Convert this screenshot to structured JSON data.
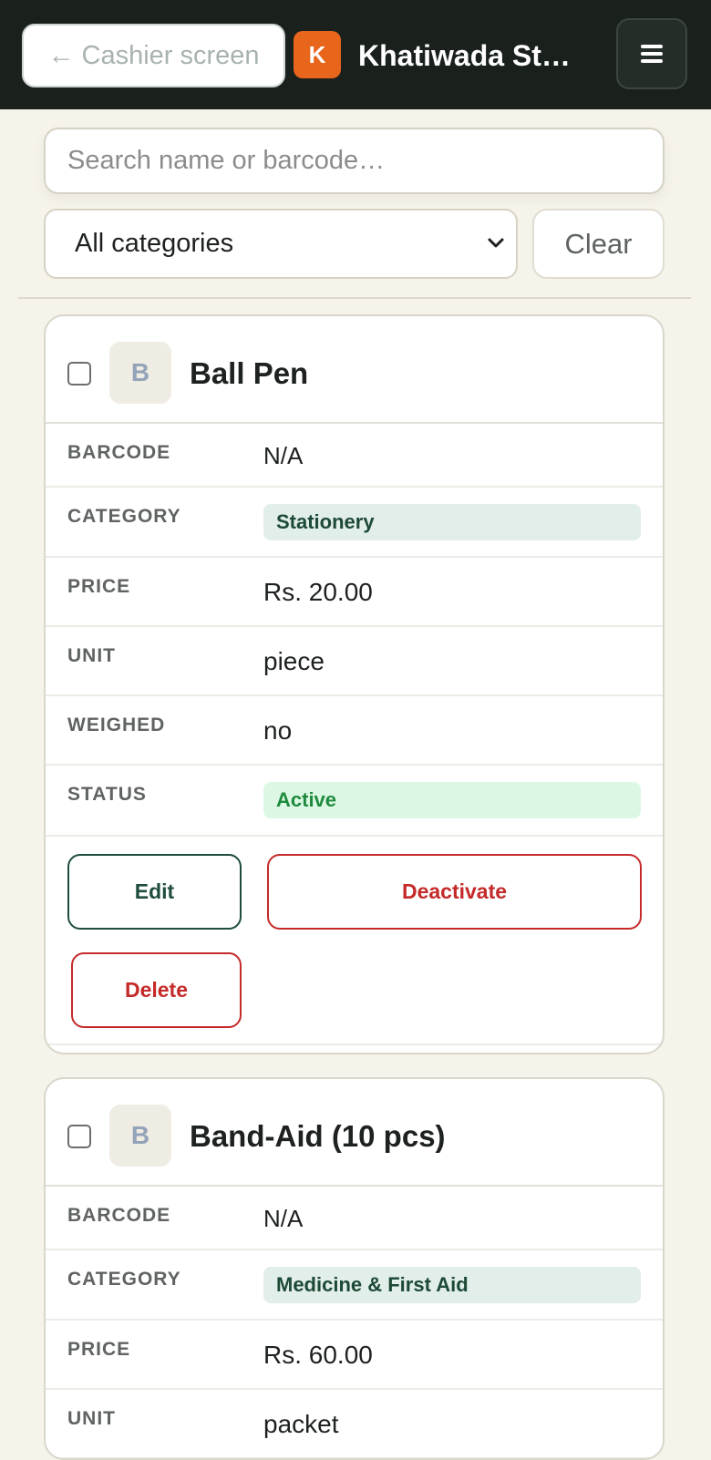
{
  "header": {
    "back_label": "← Cashier screen",
    "logo_letter": "K",
    "store_name": "Khatiwada St…",
    "menu_icon": "hamburger-icon"
  },
  "filters": {
    "search_placeholder": "Search name or barcode…",
    "search_value": "",
    "category_selected": "All categories",
    "clear_label": "Clear"
  },
  "field_labels": {
    "barcode": "BARCODE",
    "category": "CATEGORY",
    "price": "PRICE",
    "unit": "UNIT",
    "weighed": "WEIGHED",
    "status": "STATUS"
  },
  "products": [
    {
      "initial": "B",
      "name": "Ball Pen",
      "barcode": "N/A",
      "category": "Stationery",
      "price": "Rs. 20.00",
      "unit": "piece",
      "weighed": "no",
      "status": "Active",
      "actions": {
        "edit": "Edit",
        "deactivate": "Deactivate",
        "delete": "Delete"
      }
    },
    {
      "initial": "B",
      "name": "Band-Aid (10 pcs)",
      "barcode": "N/A",
      "category": "Medicine & First Aid",
      "price": "Rs. 60.00",
      "unit": "packet"
    }
  ],
  "colors": {
    "topbar": "#1a211d",
    "logo": "#e8651c",
    "accent_green": "#1f4d3b",
    "danger_red": "#c52a2a",
    "active_green": "#1f8a3e",
    "background": "#f6f3ea"
  }
}
